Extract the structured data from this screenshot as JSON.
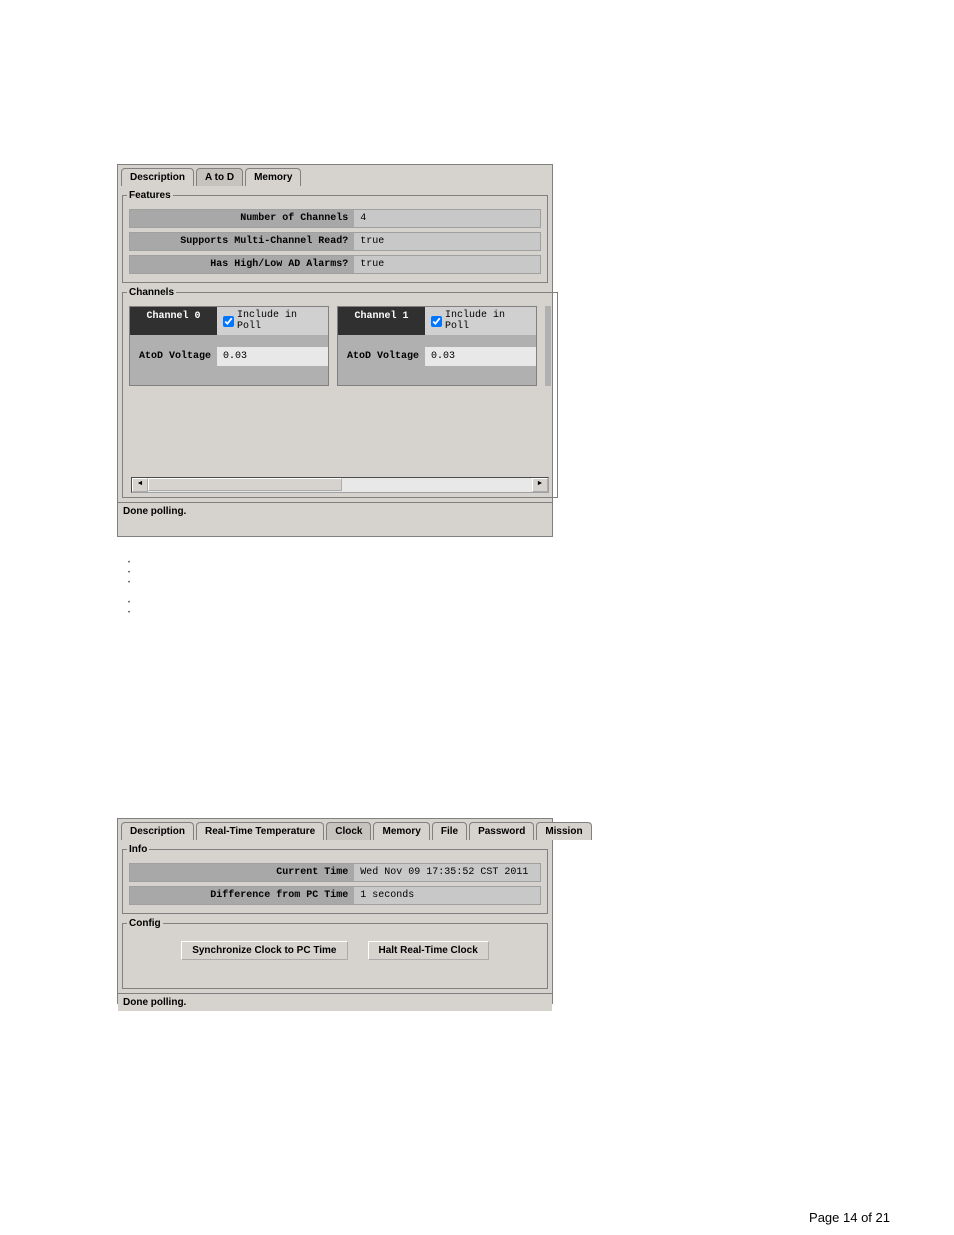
{
  "a2d_panel": {
    "tabs": [
      {
        "label": "Description"
      },
      {
        "label": "A to D",
        "active": true
      },
      {
        "label": "Memory"
      }
    ],
    "features": {
      "legend": "Features",
      "rows": [
        {
          "label": "Number of Channels",
          "value": "4"
        },
        {
          "label": "Supports Multi-Channel Read?",
          "value": "true"
        },
        {
          "label": "Has High/Low AD Alarms?",
          "value": "true"
        }
      ]
    },
    "channels": {
      "legend": "Channels",
      "include_label": "Include in Poll",
      "voltage_label": "AtoD Voltage",
      "items": [
        {
          "name": "Channel 0",
          "include": true,
          "voltage": "0.03"
        },
        {
          "name": "Channel 1",
          "include": true,
          "voltage": "0.03"
        }
      ]
    },
    "status": "Done polling."
  },
  "clock_panel": {
    "tabs": [
      {
        "label": "Description"
      },
      {
        "label": "Real-Time Temperature"
      },
      {
        "label": "Clock",
        "active": true
      },
      {
        "label": "Memory"
      },
      {
        "label": "File"
      },
      {
        "label": "Password"
      },
      {
        "label": "Mission"
      }
    ],
    "info": {
      "legend": "Info",
      "rows": [
        {
          "label": "Current Time",
          "value": "Wed Nov 09 17:35:52 CST 2011"
        },
        {
          "label": "Difference from PC Time",
          "value": "1 seconds"
        }
      ]
    },
    "config": {
      "legend": "Config",
      "sync_button": "Synchronize Clock to PC Time",
      "halt_button": "Halt Real-Time Clock"
    },
    "status": "Done polling."
  },
  "page_footer": "Page 14 of 21"
}
